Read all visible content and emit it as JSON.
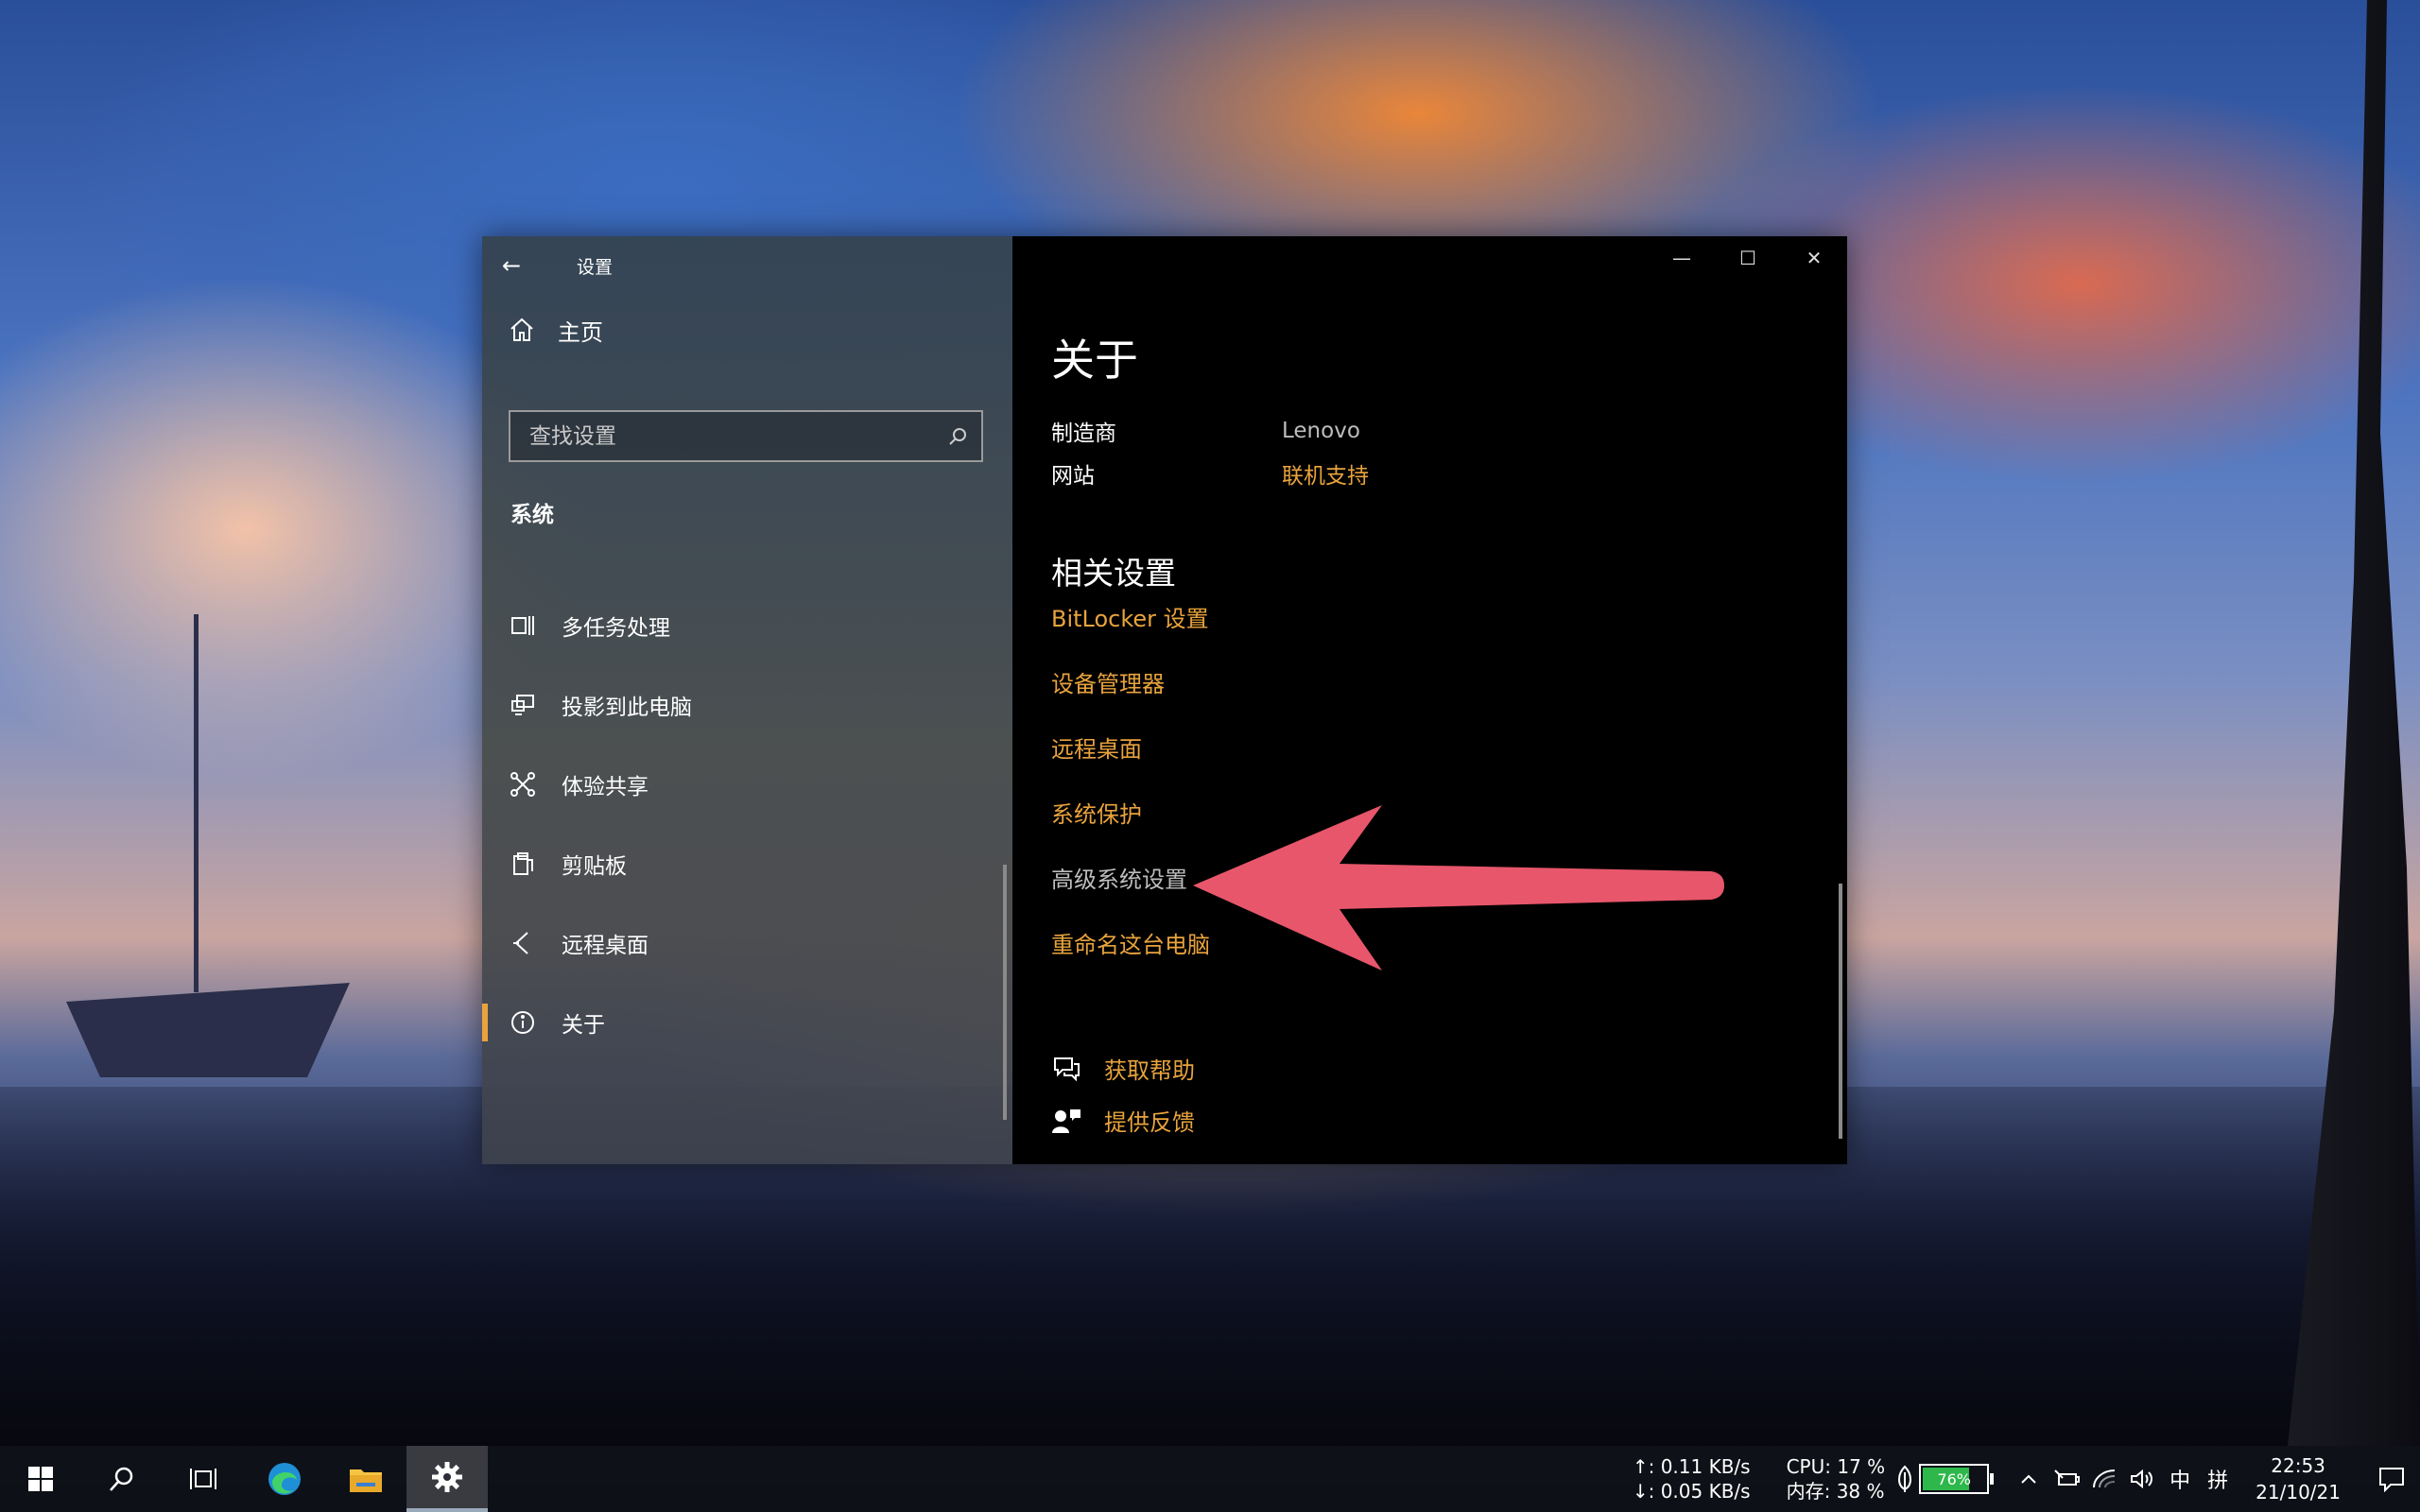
{
  "window": {
    "title": "设置",
    "back_icon": "←",
    "minimize_icon": "—",
    "maximize_icon": "☐",
    "close_icon": "✕"
  },
  "nav": {
    "home_label": "主页",
    "search_placeholder": "查找设置",
    "section": "系统",
    "items": [
      {
        "label": "多任务处理",
        "icon": "multitasking-icon"
      },
      {
        "label": "投影到此电脑",
        "icon": "projecting-icon"
      },
      {
        "label": "体验共享",
        "icon": "shared-experiences-icon"
      },
      {
        "label": "剪贴板",
        "icon": "clipboard-icon"
      },
      {
        "label": "远程桌面",
        "icon": "remote-desktop-icon"
      },
      {
        "label": "关于",
        "icon": "info-icon",
        "active": true
      }
    ]
  },
  "content": {
    "title": "关于",
    "info": [
      {
        "key": "制造商",
        "value": "Lenovo"
      },
      {
        "key": "网站",
        "value": "联机支持"
      }
    ],
    "related_title": "相关设置",
    "related": [
      "BitLocker 设置",
      "设备管理器",
      "远程桌面",
      "系统保护",
      "高级系统设置",
      "重命名这台电脑"
    ],
    "help": [
      {
        "label": "获取帮助",
        "icon": "get-help-icon"
      },
      {
        "label": "提供反馈",
        "icon": "feedback-icon"
      }
    ]
  },
  "taskbar": {
    "net_up": "↑: 0.11 KB/s",
    "net_down": "↓: 0.05 KB/s",
    "cpu": "CPU: 17 %",
    "memory": "内存: 38 %",
    "battery_percent": 76,
    "battery_label": "76%",
    "input_lang": "中",
    "input_mode": "拼",
    "time": "22:53",
    "date": "21/10/21"
  },
  "colors": {
    "accent": "#e8a33d",
    "arrow": "#e8566b"
  }
}
